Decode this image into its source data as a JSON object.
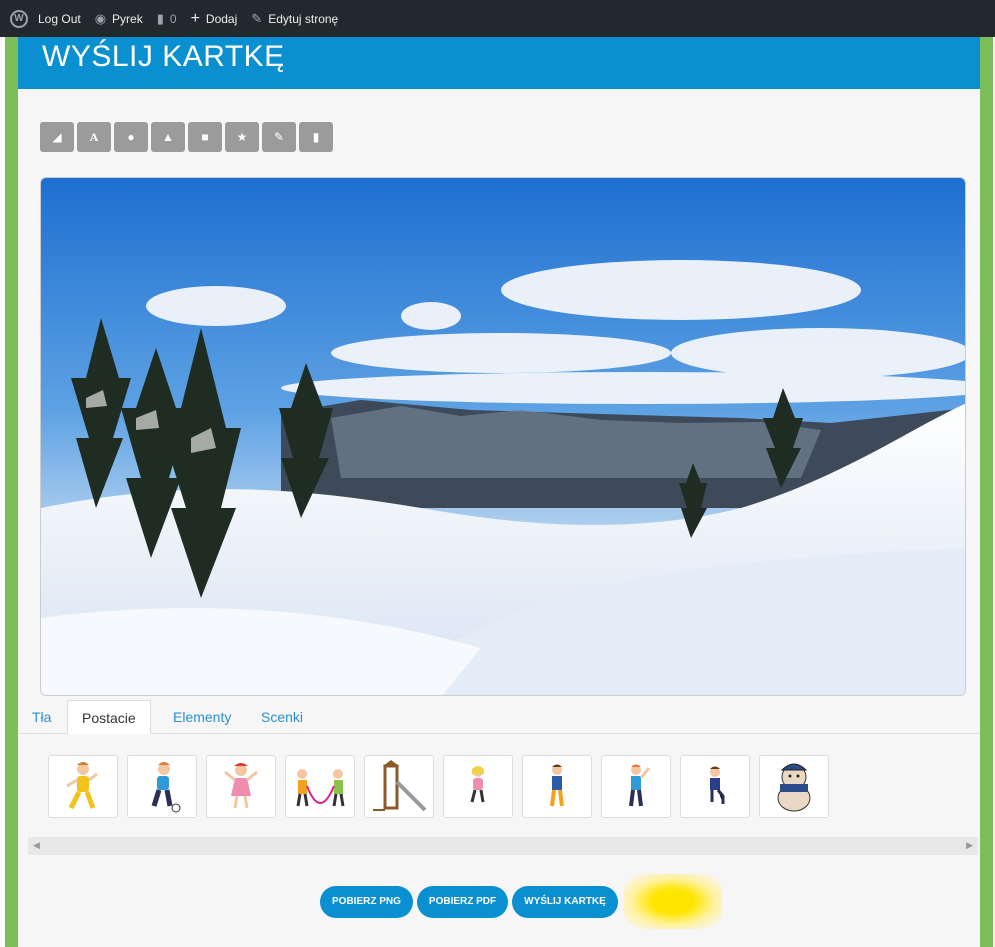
{
  "adminbar": {
    "items": [
      {
        "label": "Log Out"
      },
      {
        "label": "Pyrek",
        "icon": "dashboard-icon"
      },
      {
        "label": "0",
        "icon": "comment-icon"
      },
      {
        "label": "Dodaj",
        "icon": "plus-icon"
      },
      {
        "label": "Edytuj stronę",
        "icon": "pencil-icon"
      }
    ]
  },
  "page": {
    "title": "WYŚLIJ KARTKĘ"
  },
  "toolbar": {
    "tools": [
      "eraser-icon",
      "text-icon",
      "circle-icon",
      "triangle-icon",
      "square-icon",
      "star-icon",
      "pencil-icon",
      "trash-icon"
    ]
  },
  "tabs": [
    {
      "label": "Tła"
    },
    {
      "label": "Postacie"
    },
    {
      "label": "Elementy"
    },
    {
      "label": "Scenki"
    }
  ],
  "actions": {
    "png": "POBIERZ PNG",
    "pdf": "POBIERZ PDF",
    "send": "WYŚLIJ KARTKĘ"
  },
  "colors": {
    "accent": "#0a8fd0",
    "frame": "#7cbf5a",
    "adminbar": "#23282d"
  }
}
